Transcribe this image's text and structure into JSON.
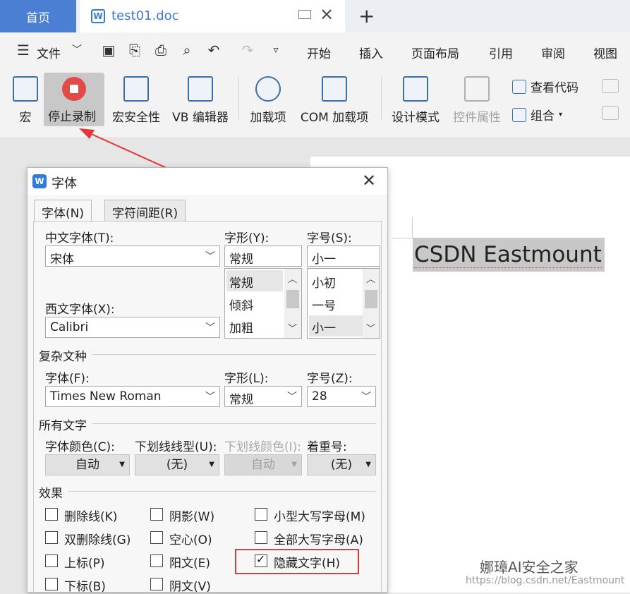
{
  "tabs": {
    "home": "首页",
    "doc_title": "test01.doc",
    "new_tab": "+"
  },
  "menu": {
    "file": "文件",
    "items": [
      "开始",
      "插入",
      "页面布局",
      "引用",
      "审阅",
      "视图"
    ]
  },
  "ribbon": {
    "macro": "宏",
    "stop_record": "停止录制",
    "macro_security": "宏安全性",
    "vb_editor": "VB 编辑器",
    "addins": "加载项",
    "com_addins": "COM 加载项",
    "design_mode": "设计模式",
    "control_props": "控件属性",
    "view_code": "查看代码",
    "group": "组合"
  },
  "document": {
    "text": "CSDN Eastmount"
  },
  "dialog": {
    "title": "字体",
    "tabs": [
      "字体(N)",
      "字符间距(R)"
    ],
    "cn_font_label": "中文字体(T):",
    "cn_font_value": "宋体",
    "style_label": "字形(Y):",
    "style_value": "常规",
    "style_options": [
      "常规",
      "倾斜",
      "加粗"
    ],
    "size_label": "字号(S):",
    "size_value": "小一",
    "size_options": [
      "小初",
      "一号",
      "小一"
    ],
    "west_font_label": "西文字体(X):",
    "west_font_value": "Calibri",
    "complex_section": "复杂文种",
    "complex_font_label": "字体(F):",
    "complex_font_value": "Times New Roman",
    "complex_style_label": "字形(L):",
    "complex_style_value": "常规",
    "complex_size_label": "字号(Z):",
    "complex_size_value": "28",
    "all_text_section": "所有文字",
    "font_color_label": "字体颜色(C):",
    "font_color_value": "自动",
    "underline_type_label": "下划线线型(U):",
    "underline_type_value": "(无)",
    "underline_color_label": "下划线颜色(I):",
    "underline_color_value": "自动",
    "emphasis_label": "着重号:",
    "emphasis_value": "(无)",
    "effects_section": "效果",
    "effects": {
      "strikethrough": "删除线(K)",
      "double_strike": "双删除线(G)",
      "superscript": "上标(P)",
      "subscript": "下标(B)",
      "shadow": "阴影(W)",
      "outline": "空心(O)",
      "emboss": "阳文(E)",
      "engrave": "阴文(V)",
      "small_caps": "小型大写字母(M)",
      "all_caps": "全部大写字母(A)",
      "hidden": "隐藏文字(H)"
    },
    "hidden_checked": true
  },
  "watermark": {
    "name": "娜璋AI安全之家",
    "url": "https://blog.csdn.net/Eastmount"
  },
  "colors": {
    "accent": "#4a7fd4",
    "highlight": "#e03a3a"
  }
}
